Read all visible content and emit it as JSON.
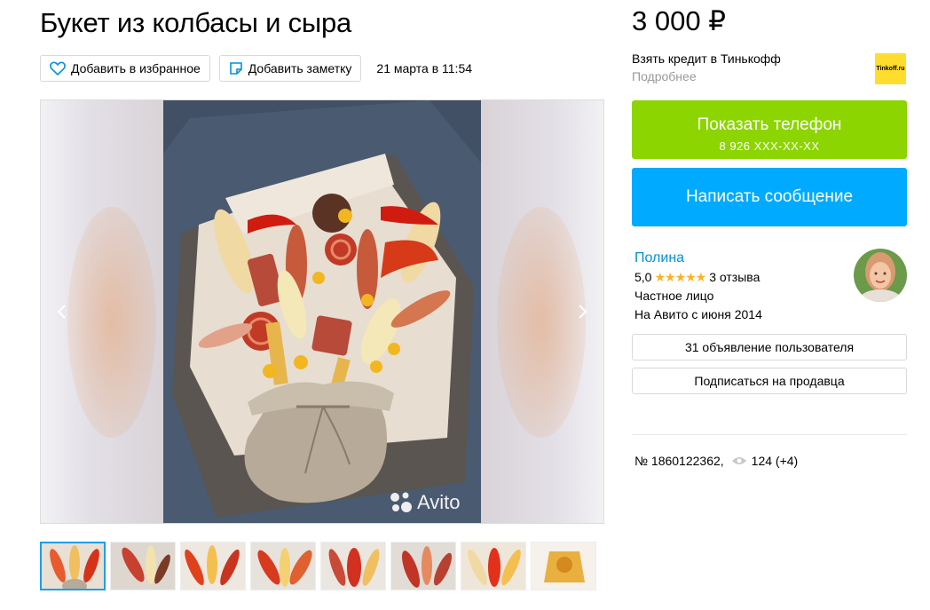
{
  "listing": {
    "title": "Букет из колбасы и сыра",
    "favorite_label": "Добавить в избранное",
    "note_label": "Добавить заметку",
    "date": "21 марта в 11:54",
    "price": "3 000 ₽",
    "number": "№ 1860122362,",
    "views": "124 (+4)"
  },
  "credit": {
    "title": "Взять кредит в Тинькофф",
    "more": "Подробнее",
    "logo_text": "Tinkoff.ru"
  },
  "contact": {
    "show_phone": "Показать телефон",
    "phone_masked": "8 926 XXX-XX-XX",
    "message": "Написать сообщение"
  },
  "seller": {
    "name": "Полина",
    "rating": "5,0",
    "stars": "★★★★★",
    "reviews": "3 отзыва",
    "type": "Частное лицо",
    "since": "На Авито с июня 2014",
    "ads_button": "31 объявление пользователя",
    "subscribe_button": "Подписаться на продавца"
  },
  "gallery": {
    "watermark": "Avito",
    "thumb_count": 8,
    "active_thumb": 1
  },
  "colors": {
    "green": "#8cd500",
    "blue": "#00aaff",
    "link": "#0091d9",
    "star": "#ffb021",
    "tinkoff_yellow": "#ffdd2d"
  }
}
